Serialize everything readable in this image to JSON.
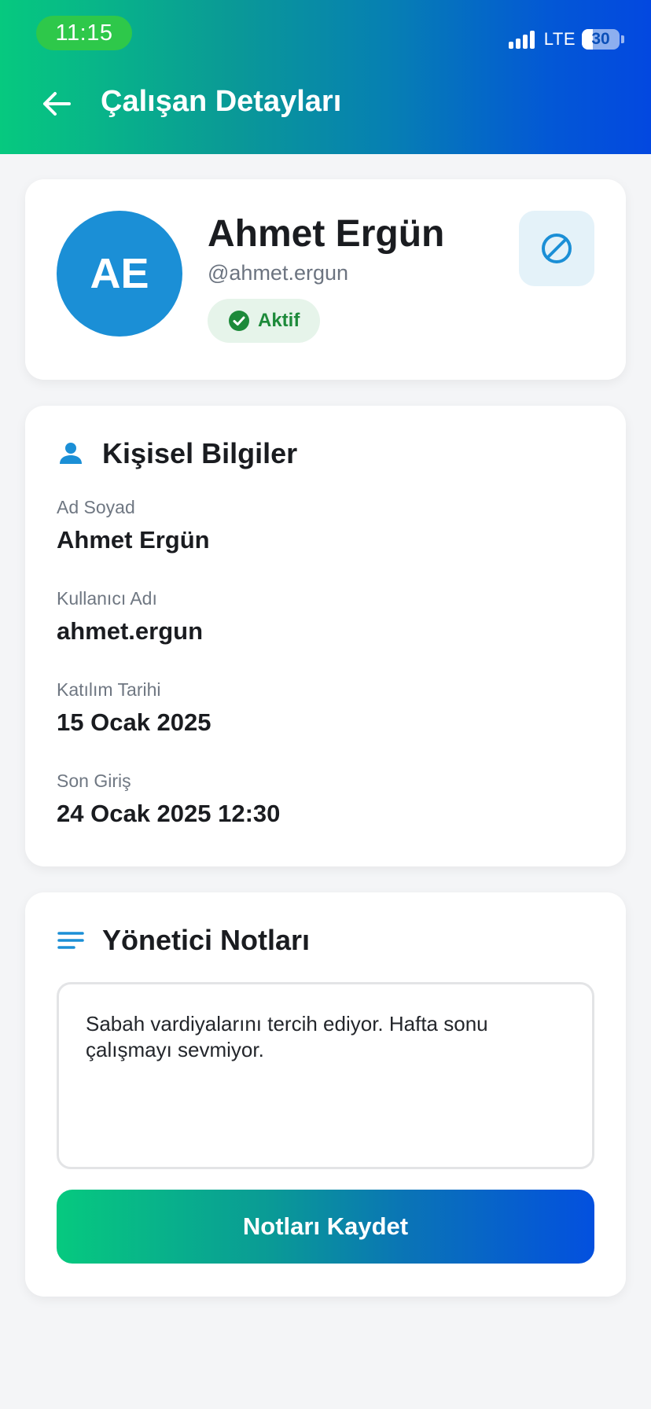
{
  "status_bar": {
    "time": "11:15",
    "network": "LTE",
    "battery": "30",
    "battery_level_percent": 30
  },
  "header": {
    "back_icon": "arrow-left-icon",
    "title": "Çalışan Detayları"
  },
  "profile": {
    "initials": "AE",
    "name": "Ahmet Ergün",
    "handle": "@ahmet.ergun",
    "status": "Aktif",
    "status_icon": "check-circle-icon",
    "block_icon": "block-icon"
  },
  "personal_info": {
    "icon": "person-icon",
    "title": "Kişisel Bilgiler",
    "fields": [
      {
        "label": "Ad Soyad",
        "value": "Ahmet Ergün"
      },
      {
        "label": "Kullanıcı Adı",
        "value": "ahmet.ergun"
      },
      {
        "label": "Katılım Tarihi",
        "value": "15 Ocak 2025"
      },
      {
        "label": "Son Giriş",
        "value": "24 Ocak 2025 12:30"
      }
    ]
  },
  "notes": {
    "icon": "notes-icon",
    "title": "Yönetici Notları",
    "text": "Sabah vardiyalarını tercih ediyor. Hafta sonu çalışmayı sevmiyor.",
    "save_label": "Notları Kaydet"
  },
  "colors": {
    "gradient_start": "#06c97f",
    "gradient_end": "#0348e0",
    "accent_blue": "#1b8fd6",
    "status_green": "#1d8a3a"
  }
}
